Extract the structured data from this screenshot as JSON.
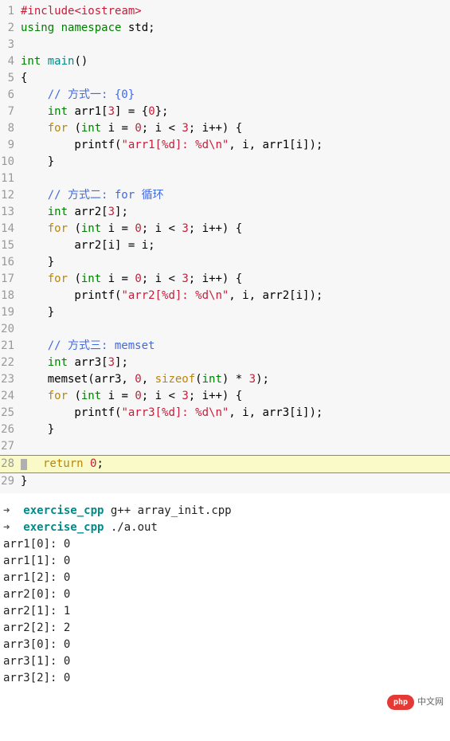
{
  "code": {
    "lines": [
      {
        "num": "1",
        "tokens": [
          {
            "t": "#include",
            "c": "preprocessor"
          },
          {
            "t": "<iostream>",
            "c": "string"
          }
        ]
      },
      {
        "num": "2",
        "tokens": [
          {
            "t": "using",
            "c": "keyword-green"
          },
          {
            "t": " ",
            "c": ""
          },
          {
            "t": "namespace",
            "c": "keyword-green"
          },
          {
            "t": " std;",
            "c": ""
          }
        ]
      },
      {
        "num": "3",
        "tokens": []
      },
      {
        "num": "4",
        "tokens": [
          {
            "t": "int",
            "c": "type"
          },
          {
            "t": " ",
            "c": ""
          },
          {
            "t": "main",
            "c": "func-name"
          },
          {
            "t": "()",
            "c": ""
          }
        ]
      },
      {
        "num": "5",
        "tokens": [
          {
            "t": "{",
            "c": ""
          }
        ]
      },
      {
        "num": "6",
        "tokens": [
          {
            "t": "    ",
            "c": ""
          },
          {
            "t": "// 方式一: {0}",
            "c": "comment"
          }
        ]
      },
      {
        "num": "7",
        "tokens": [
          {
            "t": "    ",
            "c": ""
          },
          {
            "t": "int",
            "c": "type"
          },
          {
            "t": " arr1[",
            "c": ""
          },
          {
            "t": "3",
            "c": "number"
          },
          {
            "t": "] = {",
            "c": ""
          },
          {
            "t": "0",
            "c": "number"
          },
          {
            "t": "};",
            "c": ""
          }
        ]
      },
      {
        "num": "8",
        "tokens": [
          {
            "t": "    ",
            "c": ""
          },
          {
            "t": "for",
            "c": "control"
          },
          {
            "t": " (",
            "c": ""
          },
          {
            "t": "int",
            "c": "type"
          },
          {
            "t": " i = ",
            "c": ""
          },
          {
            "t": "0",
            "c": "number"
          },
          {
            "t": "; i < ",
            "c": ""
          },
          {
            "t": "3",
            "c": "number"
          },
          {
            "t": "; i++) {",
            "c": ""
          }
        ]
      },
      {
        "num": "9",
        "tokens": [
          {
            "t": "        printf(",
            "c": ""
          },
          {
            "t": "\"arr1[%d]: %d\\n\"",
            "c": "string"
          },
          {
            "t": ", i, arr1[i]);",
            "c": ""
          }
        ]
      },
      {
        "num": "10",
        "tokens": [
          {
            "t": "    }",
            "c": ""
          }
        ]
      },
      {
        "num": "11",
        "tokens": []
      },
      {
        "num": "12",
        "tokens": [
          {
            "t": "    ",
            "c": ""
          },
          {
            "t": "// 方式二: for 循环",
            "c": "comment"
          }
        ]
      },
      {
        "num": "13",
        "tokens": [
          {
            "t": "    ",
            "c": ""
          },
          {
            "t": "int",
            "c": "type"
          },
          {
            "t": " arr2[",
            "c": ""
          },
          {
            "t": "3",
            "c": "number"
          },
          {
            "t": "];",
            "c": ""
          }
        ]
      },
      {
        "num": "14",
        "tokens": [
          {
            "t": "    ",
            "c": ""
          },
          {
            "t": "for",
            "c": "control"
          },
          {
            "t": " (",
            "c": ""
          },
          {
            "t": "int",
            "c": "type"
          },
          {
            "t": " i = ",
            "c": ""
          },
          {
            "t": "0",
            "c": "number"
          },
          {
            "t": "; i < ",
            "c": ""
          },
          {
            "t": "3",
            "c": "number"
          },
          {
            "t": "; i++) {",
            "c": ""
          }
        ]
      },
      {
        "num": "15",
        "tokens": [
          {
            "t": "        arr2[i] = i;",
            "c": ""
          }
        ]
      },
      {
        "num": "16",
        "tokens": [
          {
            "t": "    }",
            "c": ""
          }
        ]
      },
      {
        "num": "17",
        "tokens": [
          {
            "t": "    ",
            "c": ""
          },
          {
            "t": "for",
            "c": "control"
          },
          {
            "t": " (",
            "c": ""
          },
          {
            "t": "int",
            "c": "type"
          },
          {
            "t": " i = ",
            "c": ""
          },
          {
            "t": "0",
            "c": "number"
          },
          {
            "t": "; i < ",
            "c": ""
          },
          {
            "t": "3",
            "c": "number"
          },
          {
            "t": "; i++) {",
            "c": ""
          }
        ]
      },
      {
        "num": "18",
        "tokens": [
          {
            "t": "        printf(",
            "c": ""
          },
          {
            "t": "\"arr2[%d]: %d\\n\"",
            "c": "string"
          },
          {
            "t": ", i, arr2[i]);",
            "c": ""
          }
        ]
      },
      {
        "num": "19",
        "tokens": [
          {
            "t": "    }",
            "c": ""
          }
        ]
      },
      {
        "num": "20",
        "tokens": []
      },
      {
        "num": "21",
        "tokens": [
          {
            "t": "    ",
            "c": ""
          },
          {
            "t": "// 方式三: memset",
            "c": "comment"
          }
        ]
      },
      {
        "num": "22",
        "tokens": [
          {
            "t": "    ",
            "c": ""
          },
          {
            "t": "int",
            "c": "type"
          },
          {
            "t": " arr3[",
            "c": ""
          },
          {
            "t": "3",
            "c": "number"
          },
          {
            "t": "];",
            "c": ""
          }
        ]
      },
      {
        "num": "23",
        "tokens": [
          {
            "t": "    memset(arr3, ",
            "c": ""
          },
          {
            "t": "0",
            "c": "number"
          },
          {
            "t": ", ",
            "c": ""
          },
          {
            "t": "sizeof",
            "c": "control"
          },
          {
            "t": "(",
            "c": ""
          },
          {
            "t": "int",
            "c": "type"
          },
          {
            "t": ") * ",
            "c": ""
          },
          {
            "t": "3",
            "c": "number"
          },
          {
            "t": ");",
            "c": ""
          }
        ]
      },
      {
        "num": "24",
        "tokens": [
          {
            "t": "    ",
            "c": ""
          },
          {
            "t": "for",
            "c": "control"
          },
          {
            "t": " (",
            "c": ""
          },
          {
            "t": "int",
            "c": "type"
          },
          {
            "t": " i = ",
            "c": ""
          },
          {
            "t": "0",
            "c": "number"
          },
          {
            "t": "; i < ",
            "c": ""
          },
          {
            "t": "3",
            "c": "number"
          },
          {
            "t": "; i++) {",
            "c": ""
          }
        ]
      },
      {
        "num": "25",
        "tokens": [
          {
            "t": "        printf(",
            "c": ""
          },
          {
            "t": "\"arr3[%d]: %d\\n\"",
            "c": "string"
          },
          {
            "t": ", i, arr3[i]);",
            "c": ""
          }
        ]
      },
      {
        "num": "26",
        "tokens": [
          {
            "t": "    }",
            "c": ""
          }
        ]
      },
      {
        "num": "27",
        "tokens": []
      },
      {
        "num": "28",
        "tokens": [
          {
            "t": "return",
            "c": "control"
          },
          {
            "t": " ",
            "c": ""
          },
          {
            "t": "0",
            "c": "number"
          },
          {
            "t": ";",
            "c": ""
          }
        ],
        "cursor": true
      },
      {
        "num": "29",
        "tokens": [
          {
            "t": "}",
            "c": ""
          }
        ]
      }
    ]
  },
  "terminal": {
    "commands": [
      {
        "arrow": "➜",
        "path": "exercise_cpp",
        "cmd": " g++ array_init.cpp"
      },
      {
        "arrow": "➜",
        "path": "exercise_cpp",
        "cmd": " ./a.out"
      }
    ],
    "output": [
      "arr1[0]: 0",
      "arr1[1]: 0",
      "arr1[2]: 0",
      "arr2[0]: 0",
      "arr2[1]: 1",
      "arr2[2]: 2",
      "arr3[0]: 0",
      "arr3[1]: 0",
      "arr3[2]: 0"
    ]
  },
  "watermark": {
    "badge": "php",
    "text": "中文网"
  }
}
